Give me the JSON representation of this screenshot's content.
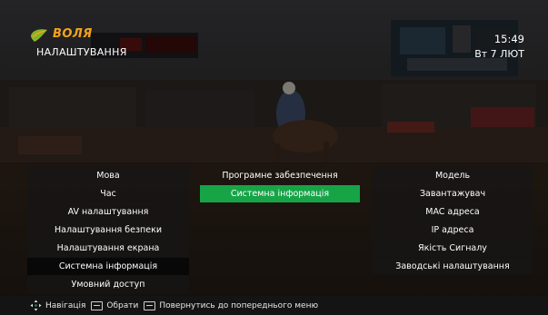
{
  "header": {
    "brand": "ВОЛЯ",
    "title": "НАЛАШТУВАННЯ",
    "time": "15:49",
    "date": "Вт 7 ЛЮТ"
  },
  "menu": {
    "left": [
      "Мова",
      "Час",
      "AV налаштування",
      "Налаштування безпеки",
      "Налаштування екрана",
      "Системна інформація",
      "Умовний доступ"
    ],
    "middle": [
      "Програмне забезпечення",
      "Системна інформація"
    ],
    "right": [
      "Модель",
      "Завантажувач",
      "MAC адреса",
      "IP адреса",
      "Якість Сигналу",
      "Заводські налаштування"
    ],
    "selected_left_index": 5,
    "active_middle_index": 1
  },
  "footer": {
    "navigate": "Навігація",
    "select": "Обрати",
    "back": "Повернутись до попереднього меню"
  },
  "colors": {
    "accent_green": "#17a447",
    "brand_orange": "#f3a31a"
  }
}
